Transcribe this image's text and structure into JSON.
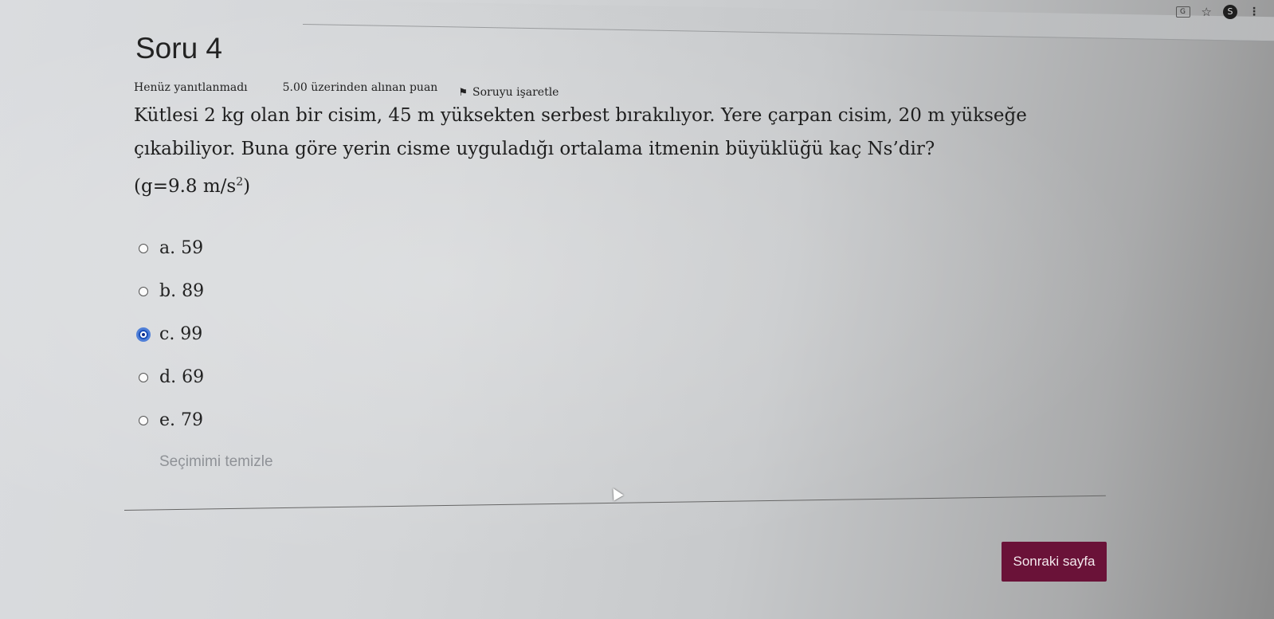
{
  "browser": {
    "icons": [
      "translate-icon",
      "star-icon",
      "profile-icon",
      "menu-icon"
    ],
    "star_glyph": "☆",
    "profile_initial": "S",
    "menu_glyph": "⋮"
  },
  "question": {
    "title": "Soru 4",
    "status": "Henüz yanıtlanmadı",
    "grade": "5.00 üzerinden alınan puan",
    "flag_label": "Soruyu işaretle",
    "text": "Kütlesi 2 kg olan bir cisim, 45 m yüksekten serbest bırakılıyor. Yere çarpan cisim, 20 m yükseğe çıkabiliyor. Buna göre yerin cisme uyguladığı ortalama itmenin büyüklüğü kaç Ns’dir?",
    "formula_prefix": "(g=9.8 m/s",
    "formula_exp": "2",
    "formula_suffix": ")"
  },
  "answers": [
    {
      "label": "a. 59",
      "selected": false
    },
    {
      "label": "b. 89",
      "selected": false
    },
    {
      "label": "c. 99",
      "selected": true
    },
    {
      "label": "d. 69",
      "selected": false
    },
    {
      "label": "e. 79",
      "selected": false
    }
  ],
  "clear_choice": "Seçimimi temizle",
  "next_button": "Sonraki sayfa",
  "colors": {
    "button_bg": "#6a1238",
    "radio_selected": "#1b4fb8",
    "clear_link": "#8f9297"
  }
}
